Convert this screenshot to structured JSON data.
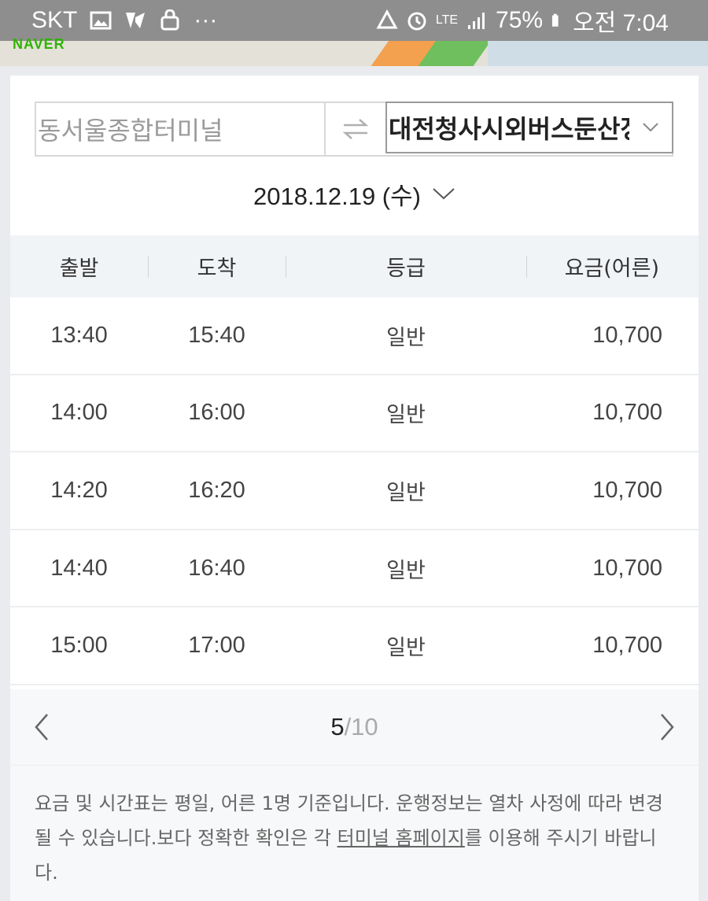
{
  "status_bar": {
    "carrier": "SKT",
    "more": "···",
    "network": "LTE",
    "battery": "75%",
    "time": "오전 7:04"
  },
  "map": {
    "brand": "NAVER"
  },
  "route": {
    "from": "동서울종합터미널",
    "to": "대전청사시외버스둔산정"
  },
  "date": "2018.12.19 (수)",
  "table": {
    "headers": [
      "출발",
      "도착",
      "등급",
      "요금(어른)"
    ],
    "rows": [
      {
        "depart": "13:40",
        "arrive": "15:40",
        "grade": "일반",
        "fare": "10,700"
      },
      {
        "depart": "14:00",
        "arrive": "16:00",
        "grade": "일반",
        "fare": "10,700"
      },
      {
        "depart": "14:20",
        "arrive": "16:20",
        "grade": "일반",
        "fare": "10,700"
      },
      {
        "depart": "14:40",
        "arrive": "16:40",
        "grade": "일반",
        "fare": "10,700"
      },
      {
        "depart": "15:00",
        "arrive": "17:00",
        "grade": "일반",
        "fare": "10,700"
      }
    ]
  },
  "pager": {
    "current": "5",
    "total": "/10"
  },
  "notice": {
    "text_before": "요금 및 시간표는 평일, 어른 1명 기준입니다. 운행정보는 열차 사정에 따라 변경될 수 있습니다.보다 정확한 확인은 각 ",
    "link": "터미널 홈페이지",
    "text_after": "를 이용해 주시기 바랍니다."
  },
  "colors": {
    "status_bar": "#8e8e8e",
    "header_bg": "#f1f4f7",
    "brand_green": "#2db400"
  }
}
